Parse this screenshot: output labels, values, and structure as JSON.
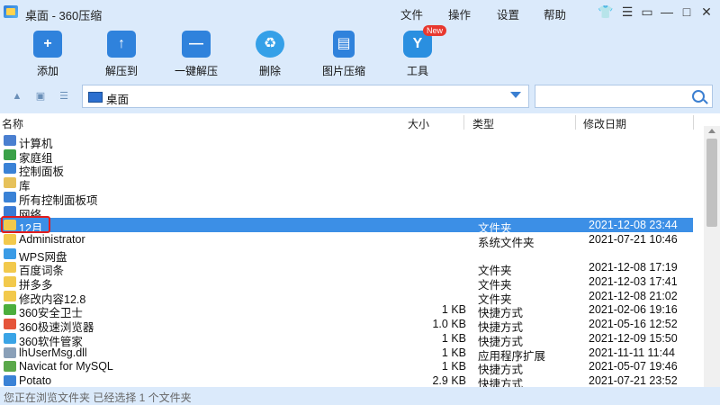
{
  "window": {
    "title": "桌面 - 360压缩"
  },
  "menu": {
    "file": "文件",
    "ops": "操作",
    "settings": "设置",
    "help": "帮助"
  },
  "toolbar": {
    "add": "添加",
    "extract_to": "解压到",
    "one_click": "一键解压",
    "delete": "删除",
    "image_compress": "图片压缩",
    "tools": "工具",
    "new_badge": "New"
  },
  "address": {
    "path": "桌面",
    "search_placeholder": ""
  },
  "columns": {
    "name": "名称",
    "size": "大小",
    "type": "类型",
    "date": "修改日期"
  },
  "rows": [
    {
      "name": "计算机",
      "size": "",
      "type": "",
      "date": "",
      "icon": "computer-icon",
      "color": "#4a7fd0"
    },
    {
      "name": "家庭组",
      "size": "",
      "type": "",
      "date": "",
      "icon": "homegroup-icon",
      "color": "#3aa148"
    },
    {
      "name": "控制面板",
      "size": "",
      "type": "",
      "date": "",
      "icon": "control-panel-icon",
      "color": "#3a82d6"
    },
    {
      "name": "库",
      "size": "",
      "type": "",
      "date": "",
      "icon": "library-icon",
      "color": "#e6c15a"
    },
    {
      "name": "所有控制面板项",
      "size": "",
      "type": "",
      "date": "",
      "icon": "control-panel-icon",
      "color": "#3a82d6"
    },
    {
      "name": "网络",
      "size": "",
      "type": "",
      "date": "",
      "icon": "network-icon",
      "color": "#3a7bd5"
    },
    {
      "name": "12月",
      "size": "",
      "type": "文件夹",
      "date": "2021-12-08 23:44",
      "icon": "folder-icon",
      "color": "#f2c94c"
    },
    {
      "name": "Administrator",
      "size": "",
      "type": "系统文件夹",
      "date": "2021-07-21 10:46",
      "icon": "user-folder-icon",
      "color": "#f2c94c"
    },
    {
      "name": "WPS网盘",
      "size": "",
      "type": "",
      "date": "",
      "icon": "cloud-icon",
      "color": "#3a9be6"
    },
    {
      "name": "百度词条",
      "size": "",
      "type": "文件夹",
      "date": "2021-12-08 17:19",
      "icon": "folder-icon",
      "color": "#f2c94c"
    },
    {
      "name": "拼多多",
      "size": "",
      "type": "文件夹",
      "date": "2021-12-03 17:41",
      "icon": "folder-icon",
      "color": "#f2c94c"
    },
    {
      "name": "修改内容12.8",
      "size": "",
      "type": "文件夹",
      "date": "2021-12-08 21:02",
      "icon": "folder-icon",
      "color": "#f2c94c"
    },
    {
      "name": "360安全卫士",
      "size": "1 KB",
      "type": "快捷方式",
      "date": "2021-02-06 19:16",
      "icon": "360-safe-icon",
      "color": "#4cae3d"
    },
    {
      "name": "360极速浏览器",
      "size": "1.0 KB",
      "type": "快捷方式",
      "date": "2021-05-16 12:52",
      "icon": "360-browser-icon",
      "color": "#e5543a"
    },
    {
      "name": "360软件管家",
      "size": "1 KB",
      "type": "快捷方式",
      "date": "2021-12-09 15:50",
      "icon": "360-software-icon",
      "color": "#3aa4e6"
    },
    {
      "name": "lhUserMsg.dll",
      "size": "1 KB",
      "type": "应用程序扩展",
      "date": "2021-11-11 11:44",
      "icon": "dll-file-icon",
      "color": "#8aa0b8"
    },
    {
      "name": "Navicat for MySQL",
      "size": "1 KB",
      "type": "快捷方式",
      "date": "2021-05-07 19:46",
      "icon": "navicat-icon",
      "color": "#5aa84a"
    },
    {
      "name": "Potato",
      "size": "2.9 KB",
      "type": "快捷方式",
      "date": "2021-07-21 23:52",
      "icon": "potato-icon",
      "color": "#3a82d6"
    }
  ],
  "selected_row": "12月",
  "status": {
    "text": "您正在浏览文件夹 已经选择 1 个文件夹"
  }
}
